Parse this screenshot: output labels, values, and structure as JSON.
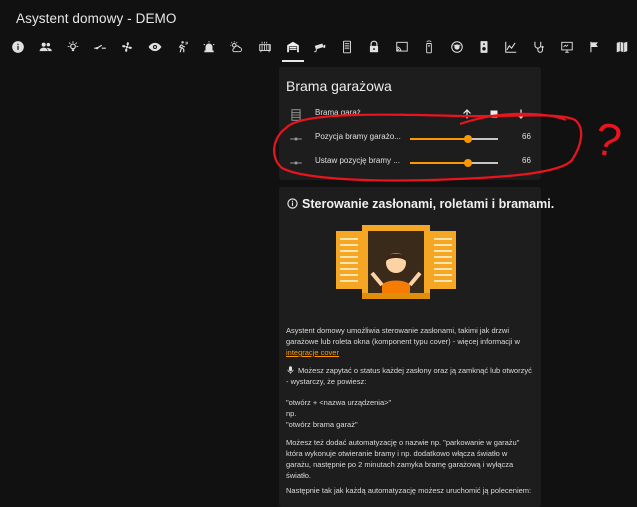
{
  "header": {
    "title": "Asystent domowy - DEMO"
  },
  "tabs": [
    {
      "icon": "info-icon"
    },
    {
      "icon": "people-icon"
    },
    {
      "icon": "bulb-icon"
    },
    {
      "icon": "switch-icon"
    },
    {
      "icon": "fan-icon"
    },
    {
      "icon": "eye-icon"
    },
    {
      "icon": "walk-icon"
    },
    {
      "icon": "alarm-light-icon"
    },
    {
      "icon": "weather-icon"
    },
    {
      "icon": "radiator-icon"
    },
    {
      "icon": "garage-icon"
    },
    {
      "icon": "camera-icon"
    },
    {
      "icon": "server-icon"
    },
    {
      "icon": "lock-icon"
    },
    {
      "icon": "cast-icon"
    },
    {
      "icon": "remote-icon"
    },
    {
      "icon": "vacuum-icon"
    },
    {
      "icon": "speaker-icon"
    },
    {
      "icon": "chart-icon"
    },
    {
      "icon": "stethoscope-icon"
    },
    {
      "icon": "monitor-icon"
    },
    {
      "icon": "flag-icon"
    },
    {
      "icon": "map-icon"
    }
  ],
  "cover_card": {
    "title": "Brama garażowa",
    "entity_label": "Brama garaż",
    "rows": [
      {
        "label": "Pozycja bramy garażo...",
        "value": "66",
        "level": 0.66
      },
      {
        "label": "Ustaw pozycję bramy ...",
        "value": "66",
        "level": 0.66
      }
    ],
    "annotation": "?",
    "colors": {
      "accent": "#ff9800",
      "annotation": "#e8141e"
    }
  },
  "info_card": {
    "title": "Sterowanie zasłonami, roletami i bramami.",
    "intro": "Asystent domowy umożliwia sterowanie zasłonami, takimi jak drzwi garażowe lub roleta okna (komponent typu cover) - więcej informacji w ",
    "link_text": "integracje cover",
    "voice_text": "Możesz zapytać o status każdej zasłony oraz ją zamknąć lub otworzyć - wystarczy, że powiesz:",
    "example_line1": "\"otwórz + <nazwa urządzenia>\"",
    "example_line2": "np.",
    "example_line3": "\"otwórz brama garaż\"",
    "automation_text": "Możesz też dodać automatyzację o nazwie np. \"parkowanie w garażu\" która wykonuje otwieranie bramy i np. dodatkowo włącza światło w garażu, następnie po 2 minutach zamyka bramę garażową i wyłącza światło.",
    "trigger_text": "Następnie tak jak każdą automatyzację możesz uruchomić ją poleceniem:"
  }
}
